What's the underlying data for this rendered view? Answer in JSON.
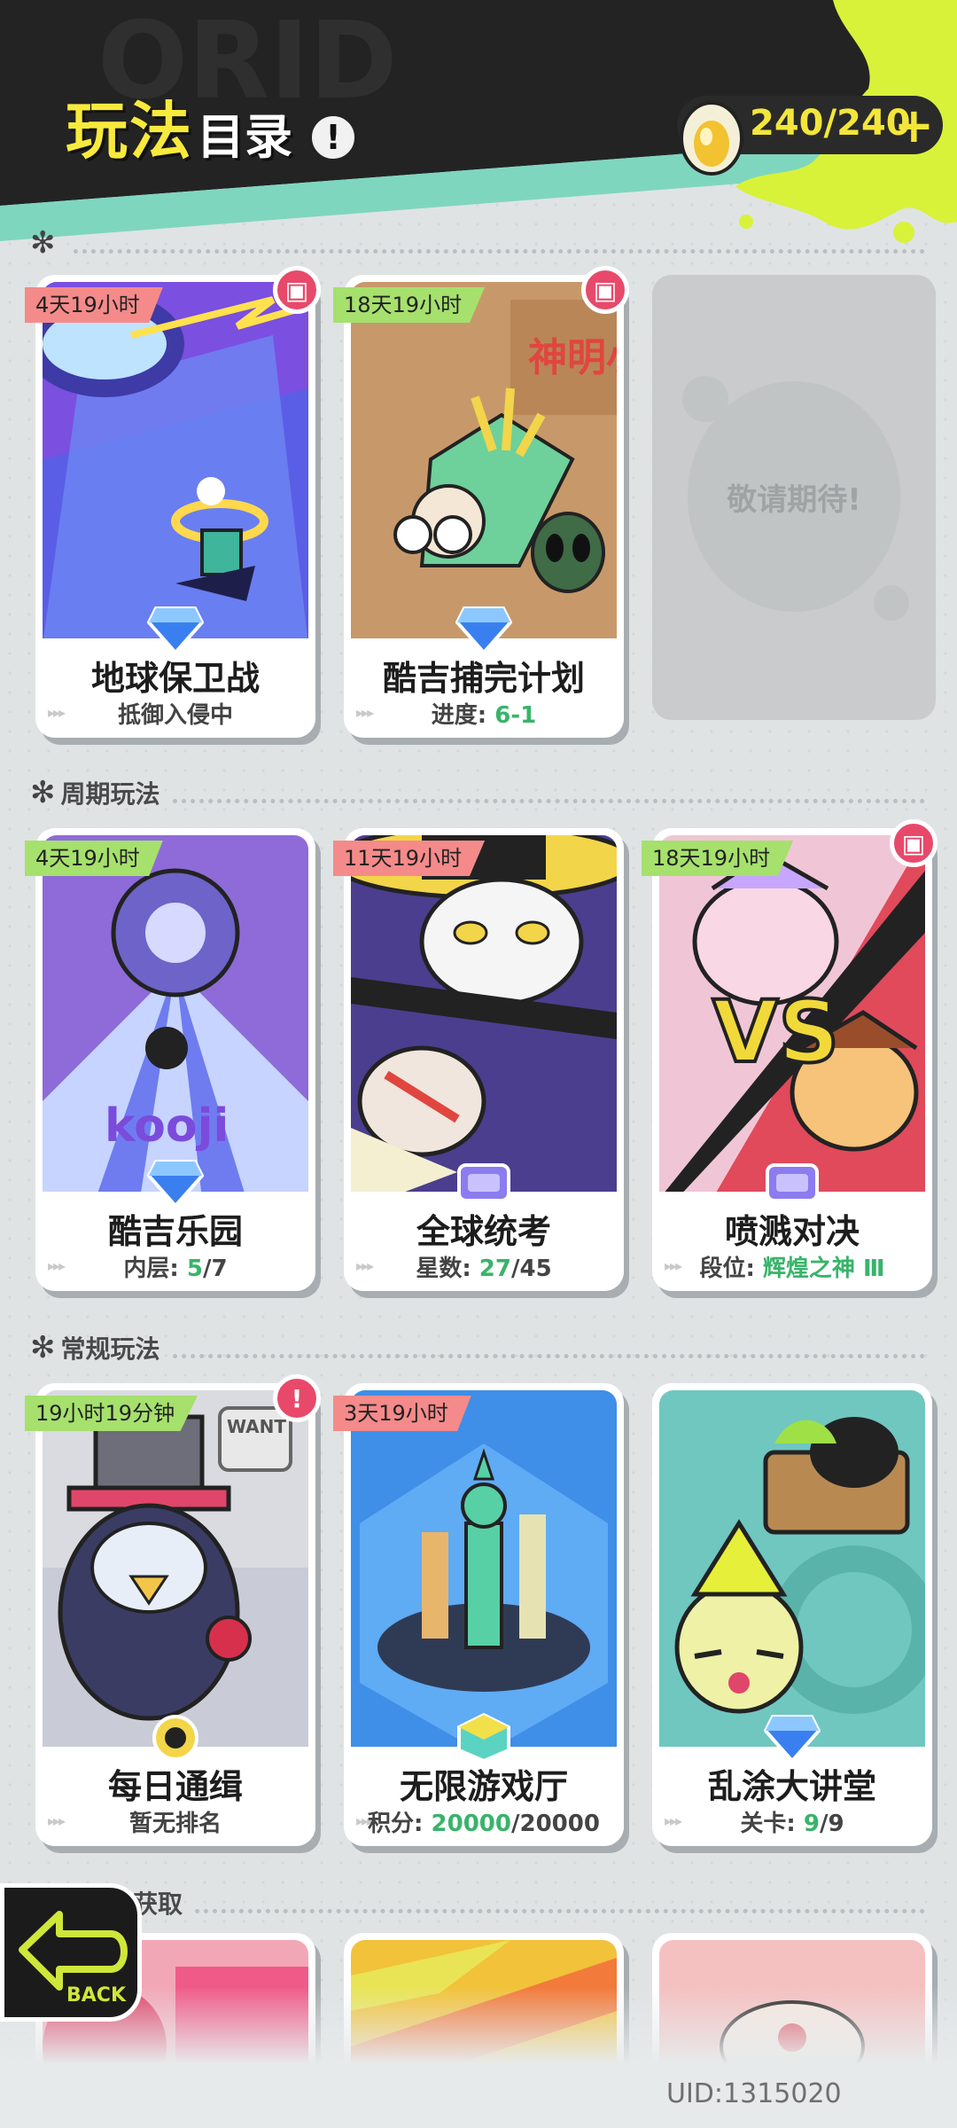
{
  "header": {
    "title_part1": "玩法",
    "title_part2": "目录",
    "info_icon": "!",
    "energy": "240/240",
    "energy_plus": "+"
  },
  "sections": {
    "limited": "",
    "periodic": "周期玩法",
    "regular": "常规玩法",
    "bottom": "获取"
  },
  "limited_cards": [
    {
      "timer": "4天19小时",
      "name": "地球保卫战",
      "sub": "抵御入侵中"
    },
    {
      "timer": "18天19小时",
      "name": "酷吉捕完计划",
      "sub_label": "进度:",
      "sub_value": "6-1"
    }
  ],
  "coming_soon": "敬请期待!",
  "periodic_cards": [
    {
      "timer": "4天19小时",
      "name": "酷吉乐园",
      "sub_label": "内层:",
      "sub_value": "5",
      "sub_total": "/7"
    },
    {
      "timer": "11天19小时",
      "name": "全球统考",
      "sub_label": "星数:",
      "sub_value": "27",
      "sub_total": "/45"
    },
    {
      "timer": "18天19小时",
      "name": "喷溅对决",
      "sub_label": "段位:",
      "sub_value": "辉煌之神 Ⅲ"
    }
  ],
  "regular_cards": [
    {
      "timer": "19小时19分钟",
      "name": "每日通缉",
      "sub": "暂无排名"
    },
    {
      "timer": "3天19小时",
      "name": "无限游戏厅",
      "sub_label": "积分:",
      "sub_value": "20000",
      "sub_total": "/20000"
    },
    {
      "name": "乱涂大讲堂",
      "sub_label": "关卡:",
      "sub_value": "9",
      "sub_total": "/9"
    }
  ],
  "art_labels": {
    "kooji": "kooji",
    "vs": "VS",
    "shenmi": "神明小队",
    "wanted": "WANT"
  },
  "back_label": "BACK",
  "uid": "UID:1315020",
  "colors": {
    "accent_yellow": "#f3e63a",
    "teal": "#78d2b8",
    "gift": "#e8496b",
    "green_value": "#38b46a"
  }
}
